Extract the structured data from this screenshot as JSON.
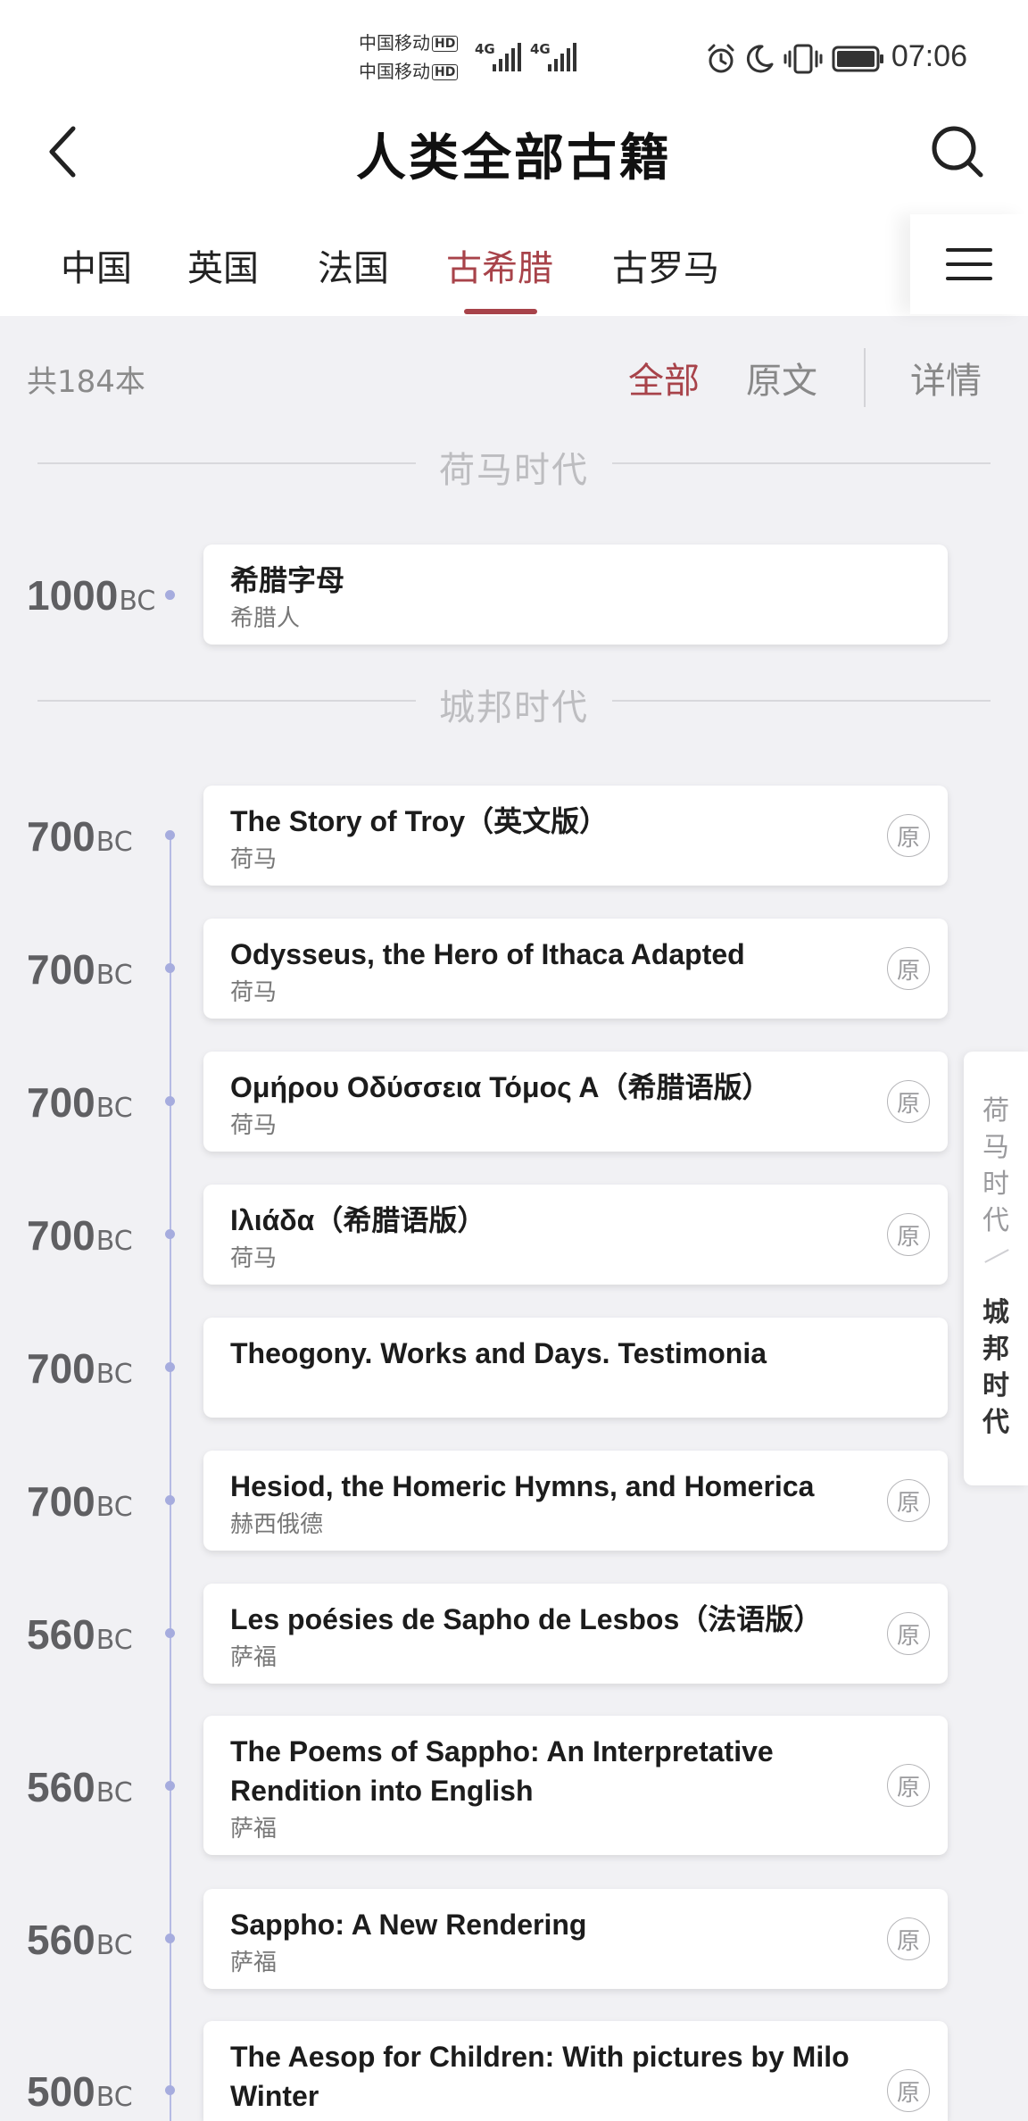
{
  "status_bar": {
    "carrier_1": "中国移动",
    "carrier_2": "中国移动",
    "hd_1": "HD",
    "hd_2": "HD",
    "net_1": "4G",
    "net_2": "4G",
    "time": "07:06",
    "icons": [
      "alarm-icon",
      "moon-icon",
      "vibrate-icon",
      "battery-icon"
    ],
    "battery_level": 1.0
  },
  "header": {
    "title": "人类全部古籍",
    "back_icon": "chevron-left-icon",
    "search_icon": "search-icon"
  },
  "tabs": {
    "items": [
      {
        "label": "中国"
      },
      {
        "label": "英国"
      },
      {
        "label": "法国"
      },
      {
        "label": "古希腊"
      },
      {
        "label": "古罗马"
      }
    ],
    "active_index": 3,
    "menu_icon": "hamburger-menu-icon"
  },
  "filter": {
    "count": "共184本",
    "all": "全部",
    "original": "原文",
    "details": "详情"
  },
  "eras": {
    "homer": "荷马时代",
    "citystate": "城邦时代"
  },
  "year_suffix": "BC",
  "books": [
    {
      "year": "1000",
      "title": "希腊字母",
      "author": "希腊人",
      "badge": ""
    },
    {
      "year": "700",
      "title": "The Story of Troy（英文版）",
      "author": "荷马",
      "badge": "原"
    },
    {
      "year": "700",
      "title": "Odysseus, the Hero of Ithaca Adapted",
      "author": "荷马",
      "badge": "原"
    },
    {
      "year": "700",
      "title": "Ομήρου Οδύσσεια Τόμος Α（希腊语版）",
      "author": "荷马",
      "badge": "原"
    },
    {
      "year": "700",
      "title": "Ιλιάδα（希腊语版）",
      "author": "荷马",
      "badge": "原"
    },
    {
      "year": "700",
      "title": "Theogony. Works and Days. Testimonia",
      "author": "",
      "badge": ""
    },
    {
      "year": "700",
      "title": "Hesiod, the Homeric Hymns, and Homerica",
      "author": "赫西俄德",
      "badge": "原"
    },
    {
      "year": "560",
      "title": "Les poésies de Sapho de Lesbos（法语版）",
      "author": "萨福",
      "badge": "原"
    },
    {
      "year": "560",
      "title": "The Poems of Sappho: An Interpretative Rendition into English",
      "author": "萨福",
      "badge": "原"
    },
    {
      "year": "560",
      "title": "Sappho: A New Rendering",
      "author": "萨福",
      "badge": "原"
    },
    {
      "year": "500",
      "title": "The Aesop for Children: With pictures by Milo Winter",
      "author": "",
      "badge": "原"
    }
  ],
  "side_nav": {
    "prev_era": [
      "荷",
      "马",
      "时",
      "代"
    ],
    "current_era": [
      "城",
      "邦",
      "时",
      "代"
    ]
  },
  "colors": {
    "accent": "#a8434a",
    "background": "#f1f1f4",
    "timeline": "#b6bbe4"
  }
}
